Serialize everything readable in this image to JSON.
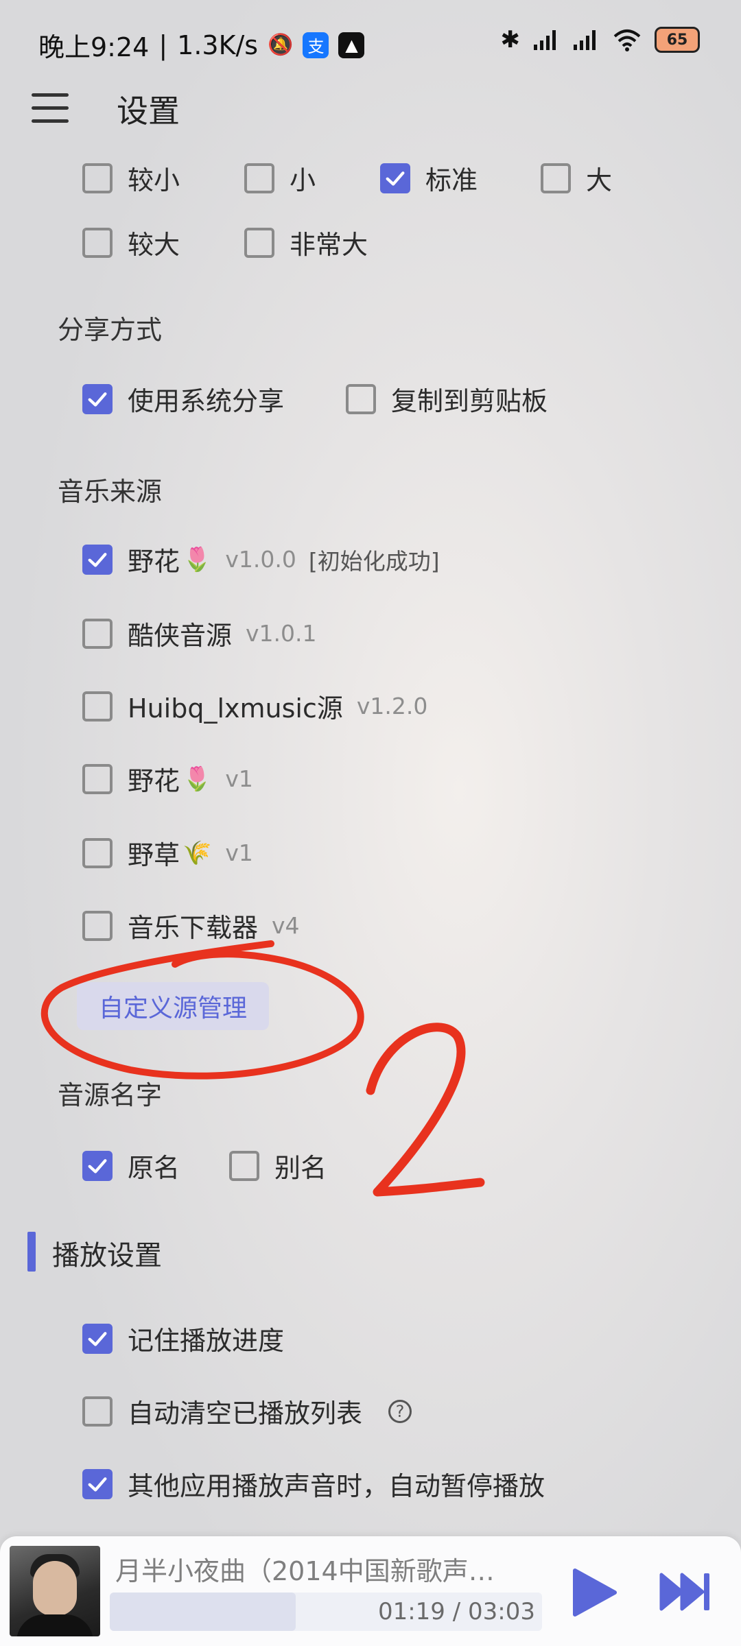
{
  "status_bar": {
    "time": "晚上9:24",
    "net_speed": "1.3K/s",
    "battery": "65"
  },
  "app": {
    "title": "设置"
  },
  "font_size": {
    "options": [
      {
        "label": "较小",
        "checked": false
      },
      {
        "label": "小",
        "checked": false
      },
      {
        "label": "标准",
        "checked": true
      },
      {
        "label": "大",
        "checked": false
      },
      {
        "label": "较大",
        "checked": false
      },
      {
        "label": "非常大",
        "checked": false
      }
    ]
  },
  "share": {
    "title": "分享方式",
    "options": [
      {
        "label": "使用系统分享",
        "checked": true
      },
      {
        "label": "复制到剪贴板",
        "checked": false
      }
    ]
  },
  "music_source": {
    "title": "音乐来源",
    "sources": [
      {
        "name": "野花",
        "emoji": "🌷",
        "version": "v1.0.0",
        "status": "[初始化成功]",
        "checked": true
      },
      {
        "name": "酷侠音源",
        "emoji": "",
        "version": "v1.0.1",
        "status": "",
        "checked": false
      },
      {
        "name": "Huibq_lxmusic源",
        "emoji": "",
        "version": "v1.2.0",
        "status": "",
        "checked": false
      },
      {
        "name": "野花",
        "emoji": "🌷",
        "version": "v1",
        "status": "",
        "checked": false
      },
      {
        "name": "野草",
        "emoji": "🌾",
        "version": "v1",
        "status": "",
        "checked": false
      },
      {
        "name": "音乐下载器",
        "emoji": "",
        "version": "v4",
        "status": "",
        "checked": false
      }
    ],
    "custom_button": "自定义源管理"
  },
  "source_name": {
    "title": "音源名字",
    "options": [
      {
        "label": "原名",
        "checked": true
      },
      {
        "label": "别名",
        "checked": false
      }
    ]
  },
  "playback": {
    "title": "播放设置",
    "options": [
      {
        "label": "记住播放进度",
        "checked": true,
        "help": false
      },
      {
        "label": "自动清空已播放列表",
        "checked": false,
        "help": true
      },
      {
        "label": "其他应用播放声音时，自动暂停播放",
        "checked": true,
        "help": false
      }
    ],
    "help_glyph": "?"
  },
  "annotation": {
    "text": "2",
    "color": "#e8321e"
  },
  "player": {
    "title": "月半小夜曲（2014中国新歌声…",
    "time": "01:19 / 03:03",
    "progress": 0.43
  },
  "colors": {
    "accent": "#5a67d8"
  }
}
